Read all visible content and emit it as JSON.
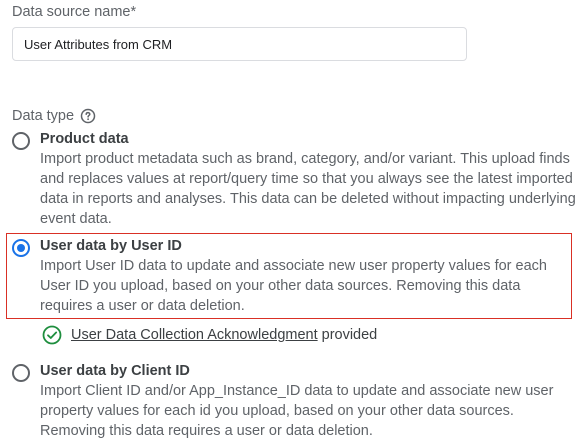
{
  "data_source": {
    "label": "Data source name*",
    "value": "User Attributes from CRM"
  },
  "data_type": {
    "label": "Data type",
    "options": [
      {
        "title": "Product data",
        "description": "Import product metadata such as brand, category, and/or variant. This upload finds and replaces values at report/query time so that you always see the latest imported data in reports and analyses. This data can be deleted without impacting underlying event data.",
        "selected": false
      },
      {
        "title": "User data by User ID",
        "description": "Import User ID data to update and associate new user property values for each User ID you upload, based on your other data sources. Removing this data requires a user or data deletion.",
        "selected": true
      },
      {
        "title": "User data by Client ID",
        "description": "Import Client ID and/or App_Instance_ID data to update and associate new user property values for each id you upload, based on your other data sources. Removing this data requires a user or data deletion.",
        "selected": false
      }
    ]
  },
  "acknowledgment": {
    "link_text": "User Data Collection Acknowledgment",
    "suffix": "provided"
  },
  "colors": {
    "accent": "#1a73e8",
    "selected_border": "#d93025",
    "success": "#1e8e3e",
    "text": "#3c4043",
    "secondary_text": "#5f6368"
  }
}
